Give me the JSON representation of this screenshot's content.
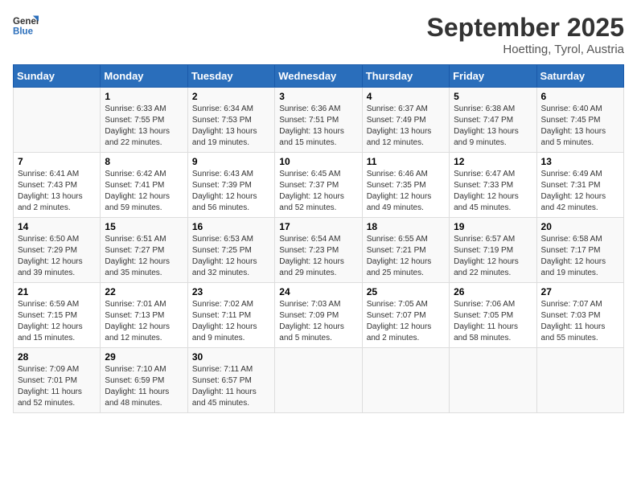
{
  "logo": {
    "general": "General",
    "blue": "Blue"
  },
  "header": {
    "title": "September 2025",
    "location": "Hoetting, Tyrol, Austria"
  },
  "weekdays": [
    "Sunday",
    "Monday",
    "Tuesday",
    "Wednesday",
    "Thursday",
    "Friday",
    "Saturday"
  ],
  "weeks": [
    [
      {
        "day": null,
        "sunrise": null,
        "sunset": null,
        "daylight": null
      },
      {
        "day": "1",
        "sunrise": "Sunrise: 6:33 AM",
        "sunset": "Sunset: 7:55 PM",
        "daylight": "Daylight: 13 hours and 22 minutes."
      },
      {
        "day": "2",
        "sunrise": "Sunrise: 6:34 AM",
        "sunset": "Sunset: 7:53 PM",
        "daylight": "Daylight: 13 hours and 19 minutes."
      },
      {
        "day": "3",
        "sunrise": "Sunrise: 6:36 AM",
        "sunset": "Sunset: 7:51 PM",
        "daylight": "Daylight: 13 hours and 15 minutes."
      },
      {
        "day": "4",
        "sunrise": "Sunrise: 6:37 AM",
        "sunset": "Sunset: 7:49 PM",
        "daylight": "Daylight: 13 hours and 12 minutes."
      },
      {
        "day": "5",
        "sunrise": "Sunrise: 6:38 AM",
        "sunset": "Sunset: 7:47 PM",
        "daylight": "Daylight: 13 hours and 9 minutes."
      },
      {
        "day": "6",
        "sunrise": "Sunrise: 6:40 AM",
        "sunset": "Sunset: 7:45 PM",
        "daylight": "Daylight: 13 hours and 5 minutes."
      }
    ],
    [
      {
        "day": "7",
        "sunrise": "Sunrise: 6:41 AM",
        "sunset": "Sunset: 7:43 PM",
        "daylight": "Daylight: 13 hours and 2 minutes."
      },
      {
        "day": "8",
        "sunrise": "Sunrise: 6:42 AM",
        "sunset": "Sunset: 7:41 PM",
        "daylight": "Daylight: 12 hours and 59 minutes."
      },
      {
        "day": "9",
        "sunrise": "Sunrise: 6:43 AM",
        "sunset": "Sunset: 7:39 PM",
        "daylight": "Daylight: 12 hours and 56 minutes."
      },
      {
        "day": "10",
        "sunrise": "Sunrise: 6:45 AM",
        "sunset": "Sunset: 7:37 PM",
        "daylight": "Daylight: 12 hours and 52 minutes."
      },
      {
        "day": "11",
        "sunrise": "Sunrise: 6:46 AM",
        "sunset": "Sunset: 7:35 PM",
        "daylight": "Daylight: 12 hours and 49 minutes."
      },
      {
        "day": "12",
        "sunrise": "Sunrise: 6:47 AM",
        "sunset": "Sunset: 7:33 PM",
        "daylight": "Daylight: 12 hours and 45 minutes."
      },
      {
        "day": "13",
        "sunrise": "Sunrise: 6:49 AM",
        "sunset": "Sunset: 7:31 PM",
        "daylight": "Daylight: 12 hours and 42 minutes."
      }
    ],
    [
      {
        "day": "14",
        "sunrise": "Sunrise: 6:50 AM",
        "sunset": "Sunset: 7:29 PM",
        "daylight": "Daylight: 12 hours and 39 minutes."
      },
      {
        "day": "15",
        "sunrise": "Sunrise: 6:51 AM",
        "sunset": "Sunset: 7:27 PM",
        "daylight": "Daylight: 12 hours and 35 minutes."
      },
      {
        "day": "16",
        "sunrise": "Sunrise: 6:53 AM",
        "sunset": "Sunset: 7:25 PM",
        "daylight": "Daylight: 12 hours and 32 minutes."
      },
      {
        "day": "17",
        "sunrise": "Sunrise: 6:54 AM",
        "sunset": "Sunset: 7:23 PM",
        "daylight": "Daylight: 12 hours and 29 minutes."
      },
      {
        "day": "18",
        "sunrise": "Sunrise: 6:55 AM",
        "sunset": "Sunset: 7:21 PM",
        "daylight": "Daylight: 12 hours and 25 minutes."
      },
      {
        "day": "19",
        "sunrise": "Sunrise: 6:57 AM",
        "sunset": "Sunset: 7:19 PM",
        "daylight": "Daylight: 12 hours and 22 minutes."
      },
      {
        "day": "20",
        "sunrise": "Sunrise: 6:58 AM",
        "sunset": "Sunset: 7:17 PM",
        "daylight": "Daylight: 12 hours and 19 minutes."
      }
    ],
    [
      {
        "day": "21",
        "sunrise": "Sunrise: 6:59 AM",
        "sunset": "Sunset: 7:15 PM",
        "daylight": "Daylight: 12 hours and 15 minutes."
      },
      {
        "day": "22",
        "sunrise": "Sunrise: 7:01 AM",
        "sunset": "Sunset: 7:13 PM",
        "daylight": "Daylight: 12 hours and 12 minutes."
      },
      {
        "day": "23",
        "sunrise": "Sunrise: 7:02 AM",
        "sunset": "Sunset: 7:11 PM",
        "daylight": "Daylight: 12 hours and 9 minutes."
      },
      {
        "day": "24",
        "sunrise": "Sunrise: 7:03 AM",
        "sunset": "Sunset: 7:09 PM",
        "daylight": "Daylight: 12 hours and 5 minutes."
      },
      {
        "day": "25",
        "sunrise": "Sunrise: 7:05 AM",
        "sunset": "Sunset: 7:07 PM",
        "daylight": "Daylight: 12 hours and 2 minutes."
      },
      {
        "day": "26",
        "sunrise": "Sunrise: 7:06 AM",
        "sunset": "Sunset: 7:05 PM",
        "daylight": "Daylight: 11 hours and 58 minutes."
      },
      {
        "day": "27",
        "sunrise": "Sunrise: 7:07 AM",
        "sunset": "Sunset: 7:03 PM",
        "daylight": "Daylight: 11 hours and 55 minutes."
      }
    ],
    [
      {
        "day": "28",
        "sunrise": "Sunrise: 7:09 AM",
        "sunset": "Sunset: 7:01 PM",
        "daylight": "Daylight: 11 hours and 52 minutes."
      },
      {
        "day": "29",
        "sunrise": "Sunrise: 7:10 AM",
        "sunset": "Sunset: 6:59 PM",
        "daylight": "Daylight: 11 hours and 48 minutes."
      },
      {
        "day": "30",
        "sunrise": "Sunrise: 7:11 AM",
        "sunset": "Sunset: 6:57 PM",
        "daylight": "Daylight: 11 hours and 45 minutes."
      },
      {
        "day": null,
        "sunrise": null,
        "sunset": null,
        "daylight": null
      },
      {
        "day": null,
        "sunrise": null,
        "sunset": null,
        "daylight": null
      },
      {
        "day": null,
        "sunrise": null,
        "sunset": null,
        "daylight": null
      },
      {
        "day": null,
        "sunrise": null,
        "sunset": null,
        "daylight": null
      }
    ]
  ]
}
